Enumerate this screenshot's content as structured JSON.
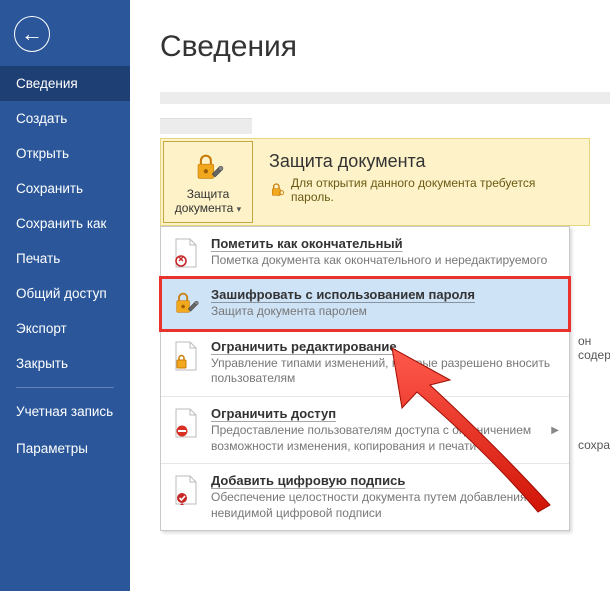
{
  "page": {
    "title": "Сведения"
  },
  "sidebar": {
    "items": [
      "Сведения",
      "Создать",
      "Открыть",
      "Сохранить",
      "Сохранить как",
      "Печать",
      "Общий доступ",
      "Экспорт",
      "Закрыть"
    ],
    "bottom": [
      "Учетная запись",
      "Параметры"
    ]
  },
  "protect": {
    "button_label": "Защита документа",
    "title": "Защита документа",
    "desc": "Для открытия данного документа требуется пароль."
  },
  "menu": [
    {
      "title": "Пометить как окончательный",
      "desc": "Пометка документа как окончательного и нередактируемого",
      "icon": "final"
    },
    {
      "title": "Зашифровать с использованием пароля",
      "desc": "Защита документа паролем",
      "icon": "lock",
      "highlight": true
    },
    {
      "title": "Ограничить редактирование",
      "desc": "Управление типами изменений, которые разрешено вносить пользователям",
      "icon": "restrict"
    },
    {
      "title": "Ограничить доступ",
      "desc": "Предоставление пользователям доступа с ограничением возможности изменения, копирования и печати",
      "icon": "denied"
    },
    {
      "title": "Добавить цифровую подпись",
      "desc": "Обеспечение целостности документа путем добавления невидимой цифровой подписи",
      "icon": "signature"
    }
  ],
  "side_notes": {
    "encrypt": "он содер",
    "restrict": "сохранен"
  }
}
